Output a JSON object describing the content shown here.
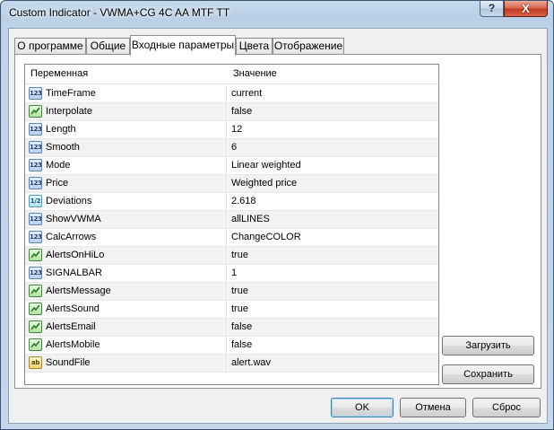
{
  "window": {
    "title": "Custom Indicator - VWMA+CG 4C AA MTF TT",
    "help_label": "?",
    "close_label": "X"
  },
  "tabs": [
    {
      "label": "О программе"
    },
    {
      "label": "Общие"
    },
    {
      "label": "Входные параметры"
    },
    {
      "label": "Цвета"
    },
    {
      "label": "Отображение"
    }
  ],
  "active_tab": "Входные параметры",
  "grid": {
    "columns": {
      "variable": "Переменная",
      "value": "Значение"
    },
    "rows": [
      {
        "name": "TimeFrame",
        "value": "current",
        "type_icon": "int-type-icon"
      },
      {
        "name": "Interpolate",
        "value": "false",
        "type_icon": "bool-type-icon"
      },
      {
        "name": "Length",
        "value": "12",
        "type_icon": "int-type-icon"
      },
      {
        "name": "Smooth",
        "value": "6",
        "type_icon": "int-type-icon"
      },
      {
        "name": "Mode",
        "value": "Linear weighted",
        "type_icon": "int-type-icon"
      },
      {
        "name": "Price",
        "value": "Weighted price",
        "type_icon": "int-type-icon"
      },
      {
        "name": "Deviations",
        "value": "2.618",
        "type_icon": "double-type-icon"
      },
      {
        "name": "ShowVWMA",
        "value": "allLINES",
        "type_icon": "int-type-icon"
      },
      {
        "name": "CalcArrows",
        "value": "ChangeCOLOR",
        "type_icon": "int-type-icon"
      },
      {
        "name": "AlertsOnHiLo",
        "value": "true",
        "type_icon": "bool-type-icon"
      },
      {
        "name": "SIGNALBAR",
        "value": "1",
        "type_icon": "int-type-icon"
      },
      {
        "name": "AlertsMessage",
        "value": "true",
        "type_icon": "bool-type-icon"
      },
      {
        "name": "AlertsSound",
        "value": "true",
        "type_icon": "bool-type-icon"
      },
      {
        "name": "AlertsEmail",
        "value": "false",
        "type_icon": "bool-type-icon"
      },
      {
        "name": "AlertsMobile",
        "value": "false",
        "type_icon": "bool-type-icon"
      },
      {
        "name": "SoundFile",
        "value": "alert.wav",
        "type_icon": "string-type-icon"
      }
    ]
  },
  "side_buttons": {
    "load": "Загрузить",
    "save": "Сохранить"
  },
  "footer_buttons": {
    "ok": "OK",
    "cancel": "Отмена",
    "reset": "Сброс"
  },
  "type_badges": {
    "int": "123",
    "double": "1/2",
    "string": "ab"
  },
  "colors": {
    "title_bar": "#bfd3e8",
    "close_button": "#c4391f",
    "default_button_border": "#3c7fb1"
  }
}
